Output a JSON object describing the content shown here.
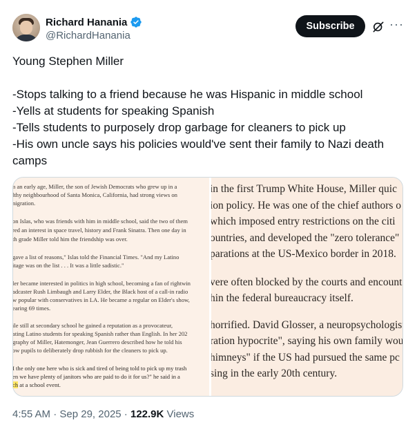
{
  "author": {
    "display_name": "Richard Hanania",
    "handle": "@RichardHanania",
    "verified": true
  },
  "header": {
    "subscribe_label": "Subscribe",
    "grok_icon": "grok-icon",
    "more_icon": "more-icon"
  },
  "tweet": {
    "lines": [
      "Young Stephen Miller",
      "",
      "-Stops talking to a friend because he was Hispanic in middle school",
      "-Yells at students for speaking Spanish",
      "-Tells students to purposely drop garbage for cleaners to pick up",
      "-His own uncle says his policies would've sent their family to Nazi death camps"
    ]
  },
  "media": {
    "left_lines": [
      "n an early age, Miller, the son of Jewish Democrats who grew up in a",
      "lthy neighbourhood of Santa Monica, California, had strong views on",
      "nigration.",
      "",
      "on Islas, who was friends with him in middle school, said the two of them",
      "red an interest in space travel, history and Frank Sinatra. Then one day in",
      "th grade Miller told him the friendship was over.",
      "",
      "gave a list of reasons,\" Islas told the Financial Times. \"And my Latino",
      "itage was on the list . . . It was a little sadistic.\"",
      "",
      "ler became interested in politics in high school, becoming a fan of rightwin",
      "adcaster Rush Limbaugh and Larry Elder, the Black host of a call-in radio",
      "w popular with conservatives in LA. He became a regular on Elder's show,",
      "earing 69 times.",
      "",
      "ile still at secondary school he gained a reputation as a provocateur,",
      "ating Latino students for speaking Spanish rather than English. In her 202",
      "graphy of Miller, Hatemonger, Jean Guerrero described how he told his",
      "ow pupils to deliberately drop rubbish for the cleaners to pick up.",
      "",
      "I the only one here who is sick and tired of being told to pick up my trash",
      "en we have plenty of janitors who are paid to do it for us?\" he said in a",
      "ch at a school event."
    ],
    "right_lines": [
      "in the first Trump White House, Miller quic",
      "ion policy. He was one of the chief authors o",
      "which imposed entry restrictions on the citi",
      "ountries, and developed the \"zero tolerance\"",
      "parations at the US-Mexico border in 2018.",
      "",
      "vere often blocked by the courts and encount",
      "hin the federal bureaucracy itself.",
      "",
      "horrified. David Glosser, a neuropsychologist",
      "ration hypocrite\", saying his own family wou",
      "himneys\" if the US had pursued the same pc",
      "sing in the early 20th century."
    ]
  },
  "meta": {
    "time": "4:55 AM",
    "separator": " · ",
    "date": "Sep 29, 2025",
    "views_count": "122.9K",
    "views_label": " Views"
  },
  "colors": {
    "accent": "#1d9bf0",
    "text": "#0f1419",
    "muted": "#536471",
    "button": "#0f1419",
    "media_bg": "#fbeee4"
  }
}
